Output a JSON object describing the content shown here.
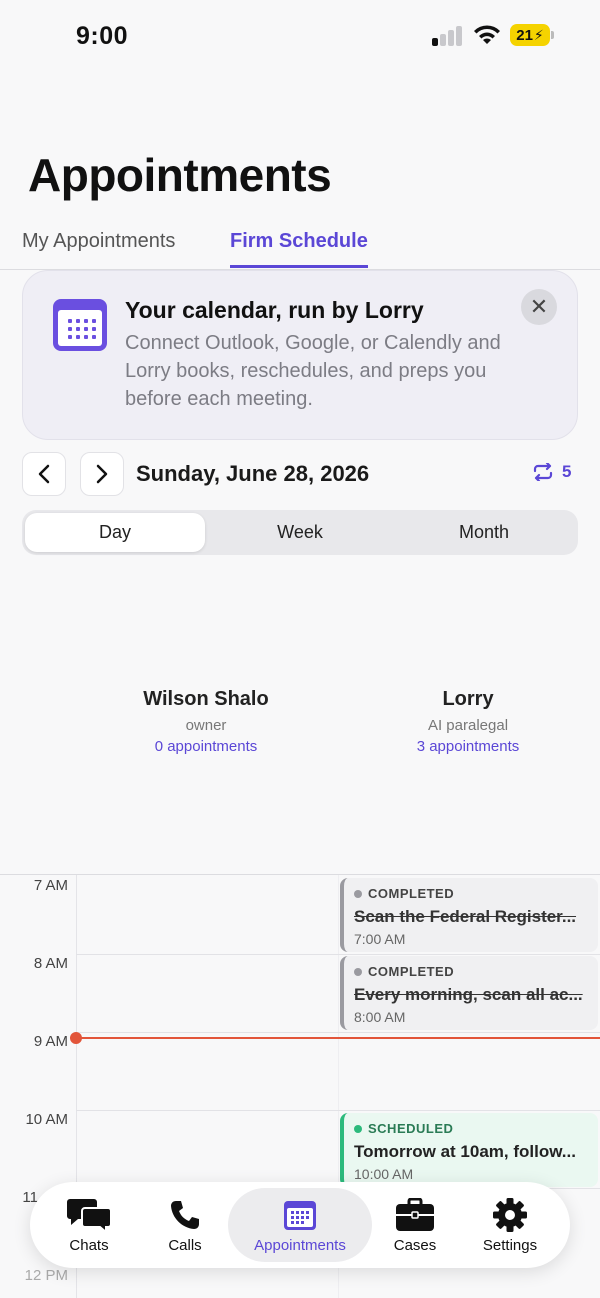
{
  "status_bar": {
    "time": "9:00",
    "battery": "21"
  },
  "page": {
    "title": "Appointments"
  },
  "tabs": [
    {
      "label": "My Appointments"
    },
    {
      "label": "Firm Schedule"
    }
  ],
  "promo": {
    "title": "Your calendar, run by Lorry",
    "body": "Connect Outlook, Google, or Calendly and Lorry books, reschedules, and preps you before each meeting."
  },
  "date_nav": {
    "date": "Sunday, June 28, 2026",
    "sync_count": "5"
  },
  "views": [
    {
      "label": "Day"
    },
    {
      "label": "Week"
    },
    {
      "label": "Month"
    }
  ],
  "people": [
    {
      "name": "Wilson Shalo",
      "role": "owner",
      "count": "0 appointments"
    },
    {
      "name": "Lorry",
      "role": "AI paralegal",
      "count": "3 appointments"
    }
  ],
  "hours": [
    "7 AM",
    "8 AM",
    "9 AM",
    "10 AM",
    "11",
    "12 PM"
  ],
  "events": [
    {
      "status": "COMPLETED",
      "title": "Scan the Federal Register...",
      "time": "7:00 AM"
    },
    {
      "status": "COMPLETED",
      "title": "Every morning, scan all ac...",
      "time": "8:00 AM"
    },
    {
      "status": "SCHEDULED",
      "title": "Tomorrow at 10am, follow...",
      "time": "10:00 AM"
    }
  ],
  "tabbar": [
    {
      "label": "Chats"
    },
    {
      "label": "Calls"
    },
    {
      "label": "Appointments"
    },
    {
      "label": "Cases"
    },
    {
      "label": "Settings"
    }
  ],
  "colors": {
    "accent": "#5b47d6",
    "now": "#e2553a",
    "scheduled": "#2cba7c",
    "battery": "#f5d300"
  }
}
